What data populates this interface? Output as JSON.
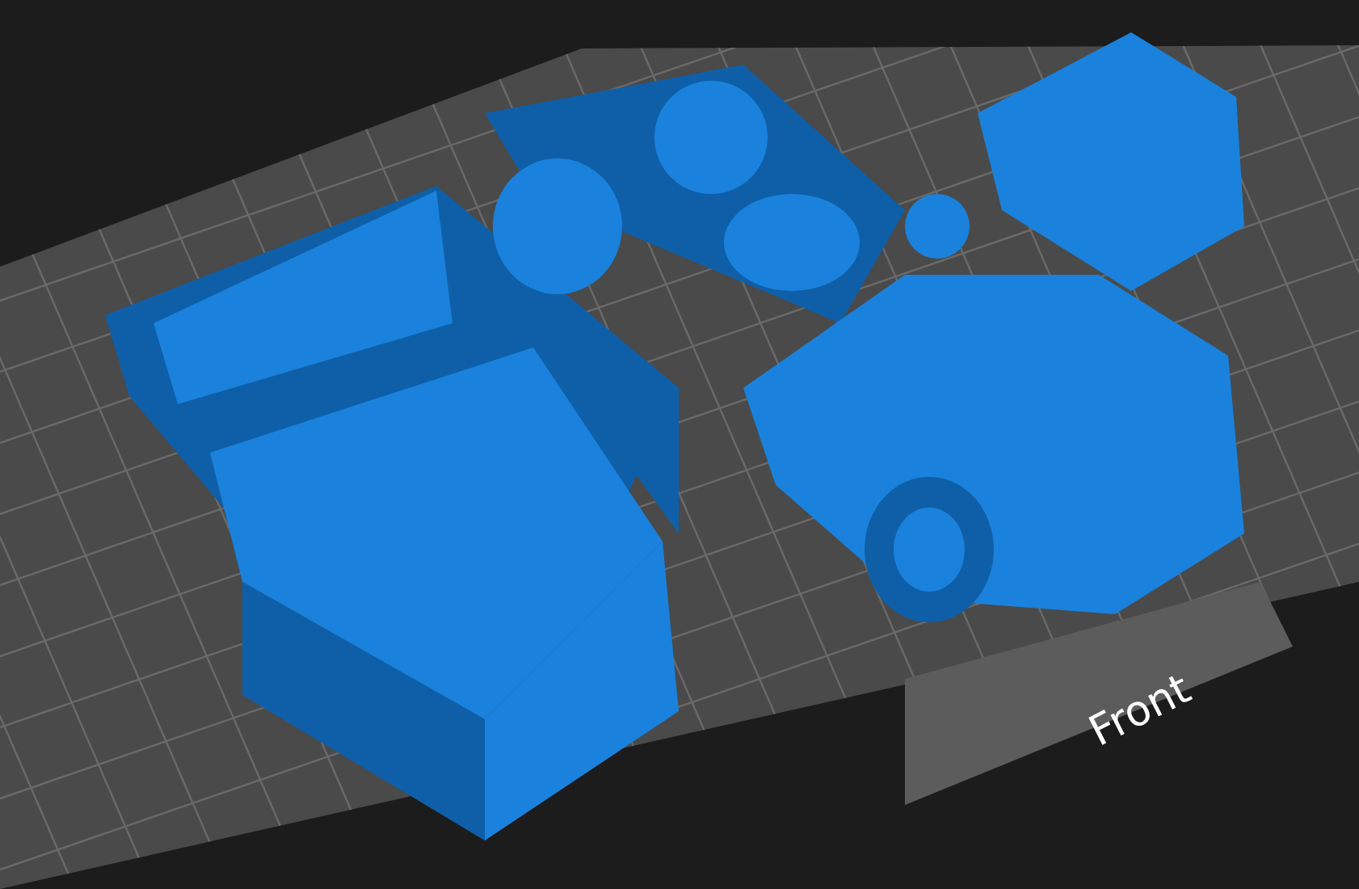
{
  "viewport": {
    "front_label": "Front"
  }
}
